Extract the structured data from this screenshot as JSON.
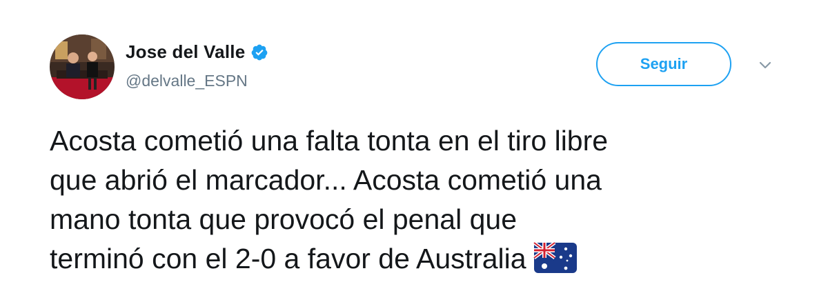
{
  "author": {
    "display_name": "Jose del Valle",
    "handle": "@delvalle_ESPN",
    "verified": true
  },
  "follow_button": {
    "label": "Seguir"
  },
  "icons": {
    "verified": "verified-badge-icon",
    "menu": "chevron-down-icon",
    "flag": "australia-flag-icon"
  },
  "tweet": {
    "lines": [
      "Acosta cometió una falta tonta en el tiro libre",
      "que abrió el marcador... Acosta cometió una",
      "mano tonta que provocó el penal que",
      "terminó con el 2-0 a favor de Australia"
    ]
  },
  "colors": {
    "accent": "#1da1f2",
    "text": "#14171a",
    "secondary": "#657786"
  }
}
